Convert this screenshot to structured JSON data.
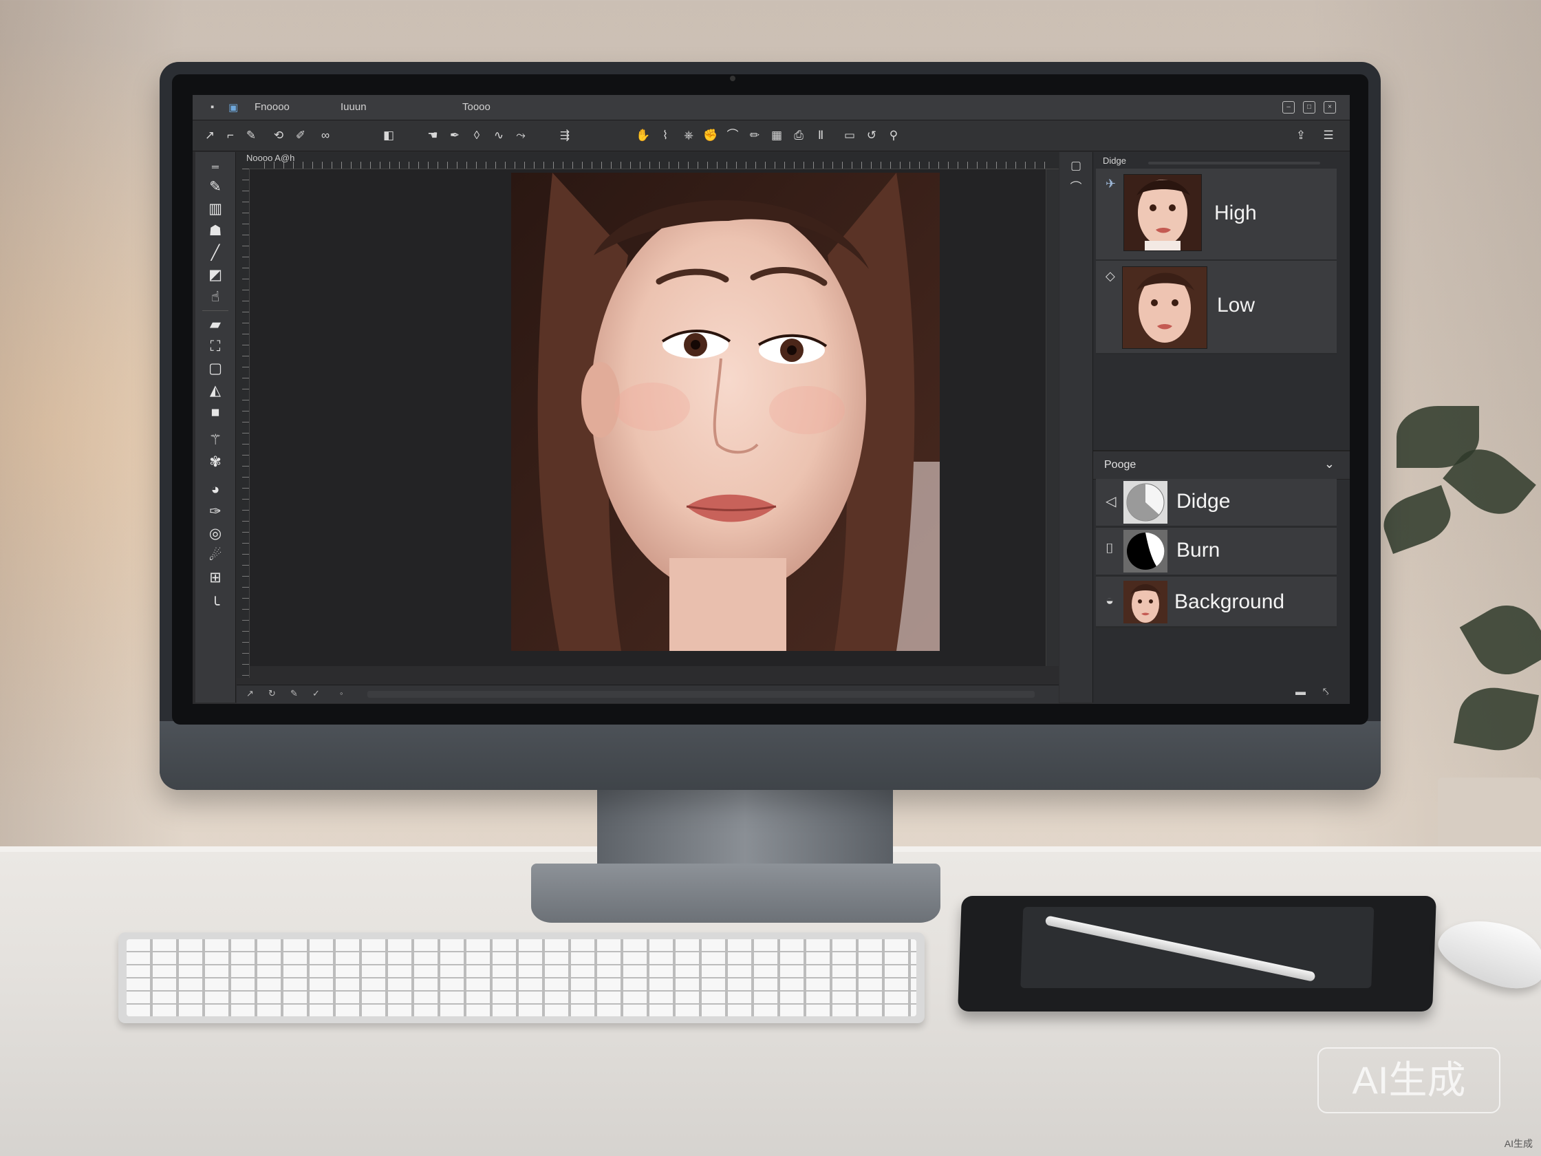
{
  "app": {
    "menu": [
      "Fnoooo",
      "Iuuun",
      "Toooo"
    ]
  },
  "document": {
    "tab_label": "Noooo A@h"
  },
  "history_panel": {
    "title": "Didge",
    "items": [
      {
        "label": "High",
        "icon": "brush-icon"
      },
      {
        "label": "Low",
        "icon": "lasso-icon"
      }
    ]
  },
  "layers_panel": {
    "title": "Pooge",
    "layers": [
      {
        "label": "Didge",
        "thumb": "dodge-circle"
      },
      {
        "label": "Burn",
        "thumb": "burn-circle"
      },
      {
        "label": "Background",
        "thumb": "portrait"
      }
    ]
  },
  "watermark": "AI生成",
  "corner_mark": "AI生成",
  "colors": {
    "ui_dark": "#2c2c2e",
    "panel": "#3b3c3f",
    "accent": "#9cb6d6"
  }
}
